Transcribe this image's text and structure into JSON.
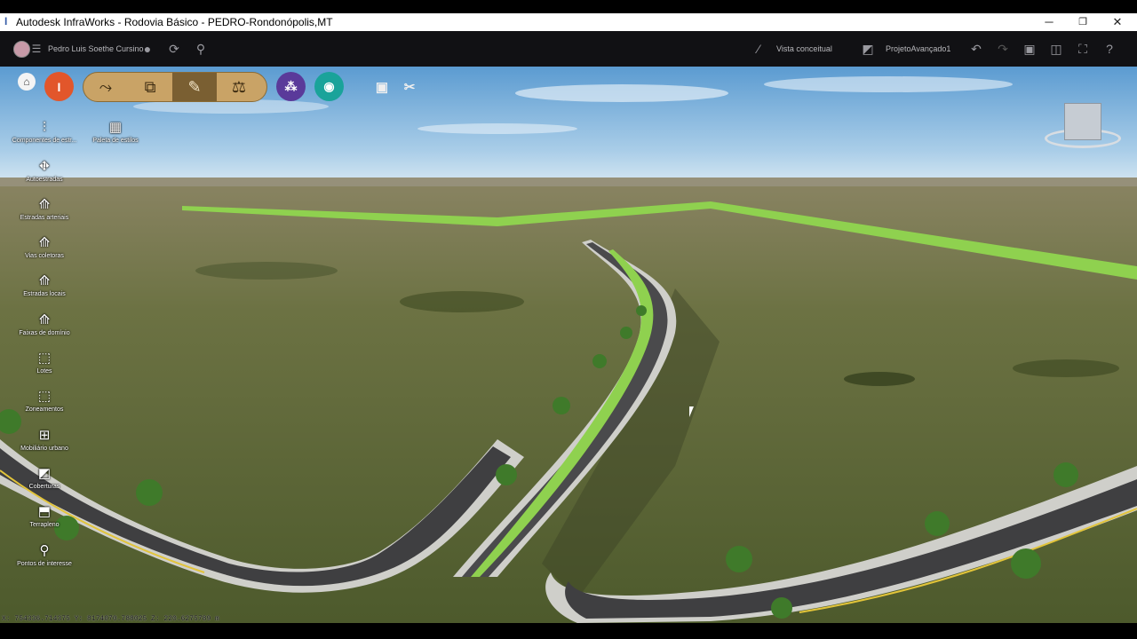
{
  "window": {
    "title": "Autodesk InfraWorks - Rodovia Básico - PEDRO-Rondonópolis,MT",
    "minimize": "─",
    "maximize": "❐",
    "close": "✕"
  },
  "toolbar": {
    "user_name": "Pedro Luis Soethe Cursino",
    "view_label": "Vista conceitual",
    "project_label": "ProjetoAvançado1"
  },
  "palette": {
    "home_icon": "home-icon",
    "groups": [
      "road-design",
      "copy-layers",
      "create-manage",
      "analyze"
    ],
    "colors": {
      "red": "#e2562b",
      "purple": "#5a3a9a",
      "teal": "#1aa39a",
      "gold": "#c9a366"
    }
  },
  "left_panel": {
    "top_tools": [
      {
        "label": "Componentes de estr..."
      },
      {
        "label": "Paleta de estilos"
      }
    ],
    "tools": [
      {
        "label": "Autoestradas"
      },
      {
        "label": "Estradas arteriais"
      },
      {
        "label": "Vias coletoras"
      },
      {
        "label": "Estradas locais"
      },
      {
        "label": "Faixas de domínio"
      },
      {
        "label": "Lotes"
      },
      {
        "label": "Zoneamentos"
      },
      {
        "label": "Mobiliário urbano"
      },
      {
        "label": "Coberturas"
      },
      {
        "label": "Terrapleno"
      },
      {
        "label": "Pontos de interesse"
      }
    ]
  },
  "status": {
    "coordinates": "X: 754336.714375  Y: 8174070.788025  Z: 220.6275789 m"
  }
}
